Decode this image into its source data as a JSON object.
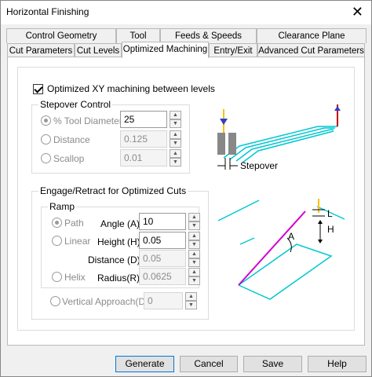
{
  "window": {
    "title": "Horizontal Finishing",
    "close_glyph": "✕"
  },
  "tabs_row1": [
    "Control Geometry",
    "Tool",
    "Feeds & Speeds",
    "Clearance Plane"
  ],
  "tabs_row2": [
    "Cut Parameters",
    "Cut Levels",
    "Optimized Machining",
    "Entry/Exit",
    "Advanced Cut Parameters"
  ],
  "active_tab": "Optimized Machining",
  "optimized": {
    "checkbox_label": "Optimized XY machining between levels",
    "checked": true
  },
  "stepover": {
    "legend": "Stepover Control",
    "options": [
      {
        "label": "% Tool Diameter",
        "value": "25",
        "selected": true
      },
      {
        "label": "Distance",
        "value": "0.125",
        "selected": false
      },
      {
        "label": "Scallop",
        "value": "0.01",
        "selected": false
      }
    ],
    "diagram_label": "Stepover"
  },
  "engage": {
    "legend": "Engage/Retract for Optimized Cuts",
    "ramp_legend": "Ramp",
    "path": "Path",
    "linear": "Linear",
    "helix": "Helix",
    "angle_label": "Angle (A)",
    "angle_value": "10",
    "height_label": "Height (H)",
    "height_value": "0.05",
    "distance_label": "Distance (D)",
    "distance_value": "0.05",
    "radius_label": "Radius(R)",
    "radius_value": "0.0625",
    "vertical_label": "Vertical Approach(D)",
    "vertical_value": "0",
    "diagram_labels": {
      "l": "L",
      "h": "H",
      "a": "A"
    }
  },
  "buttons": {
    "generate": "Generate",
    "cancel": "Cancel",
    "save": "Save",
    "help": "Help"
  },
  "colors": {
    "toolpath": "#00c8d2",
    "ramp": "#d000d0",
    "tool_marker": "#c00000"
  }
}
